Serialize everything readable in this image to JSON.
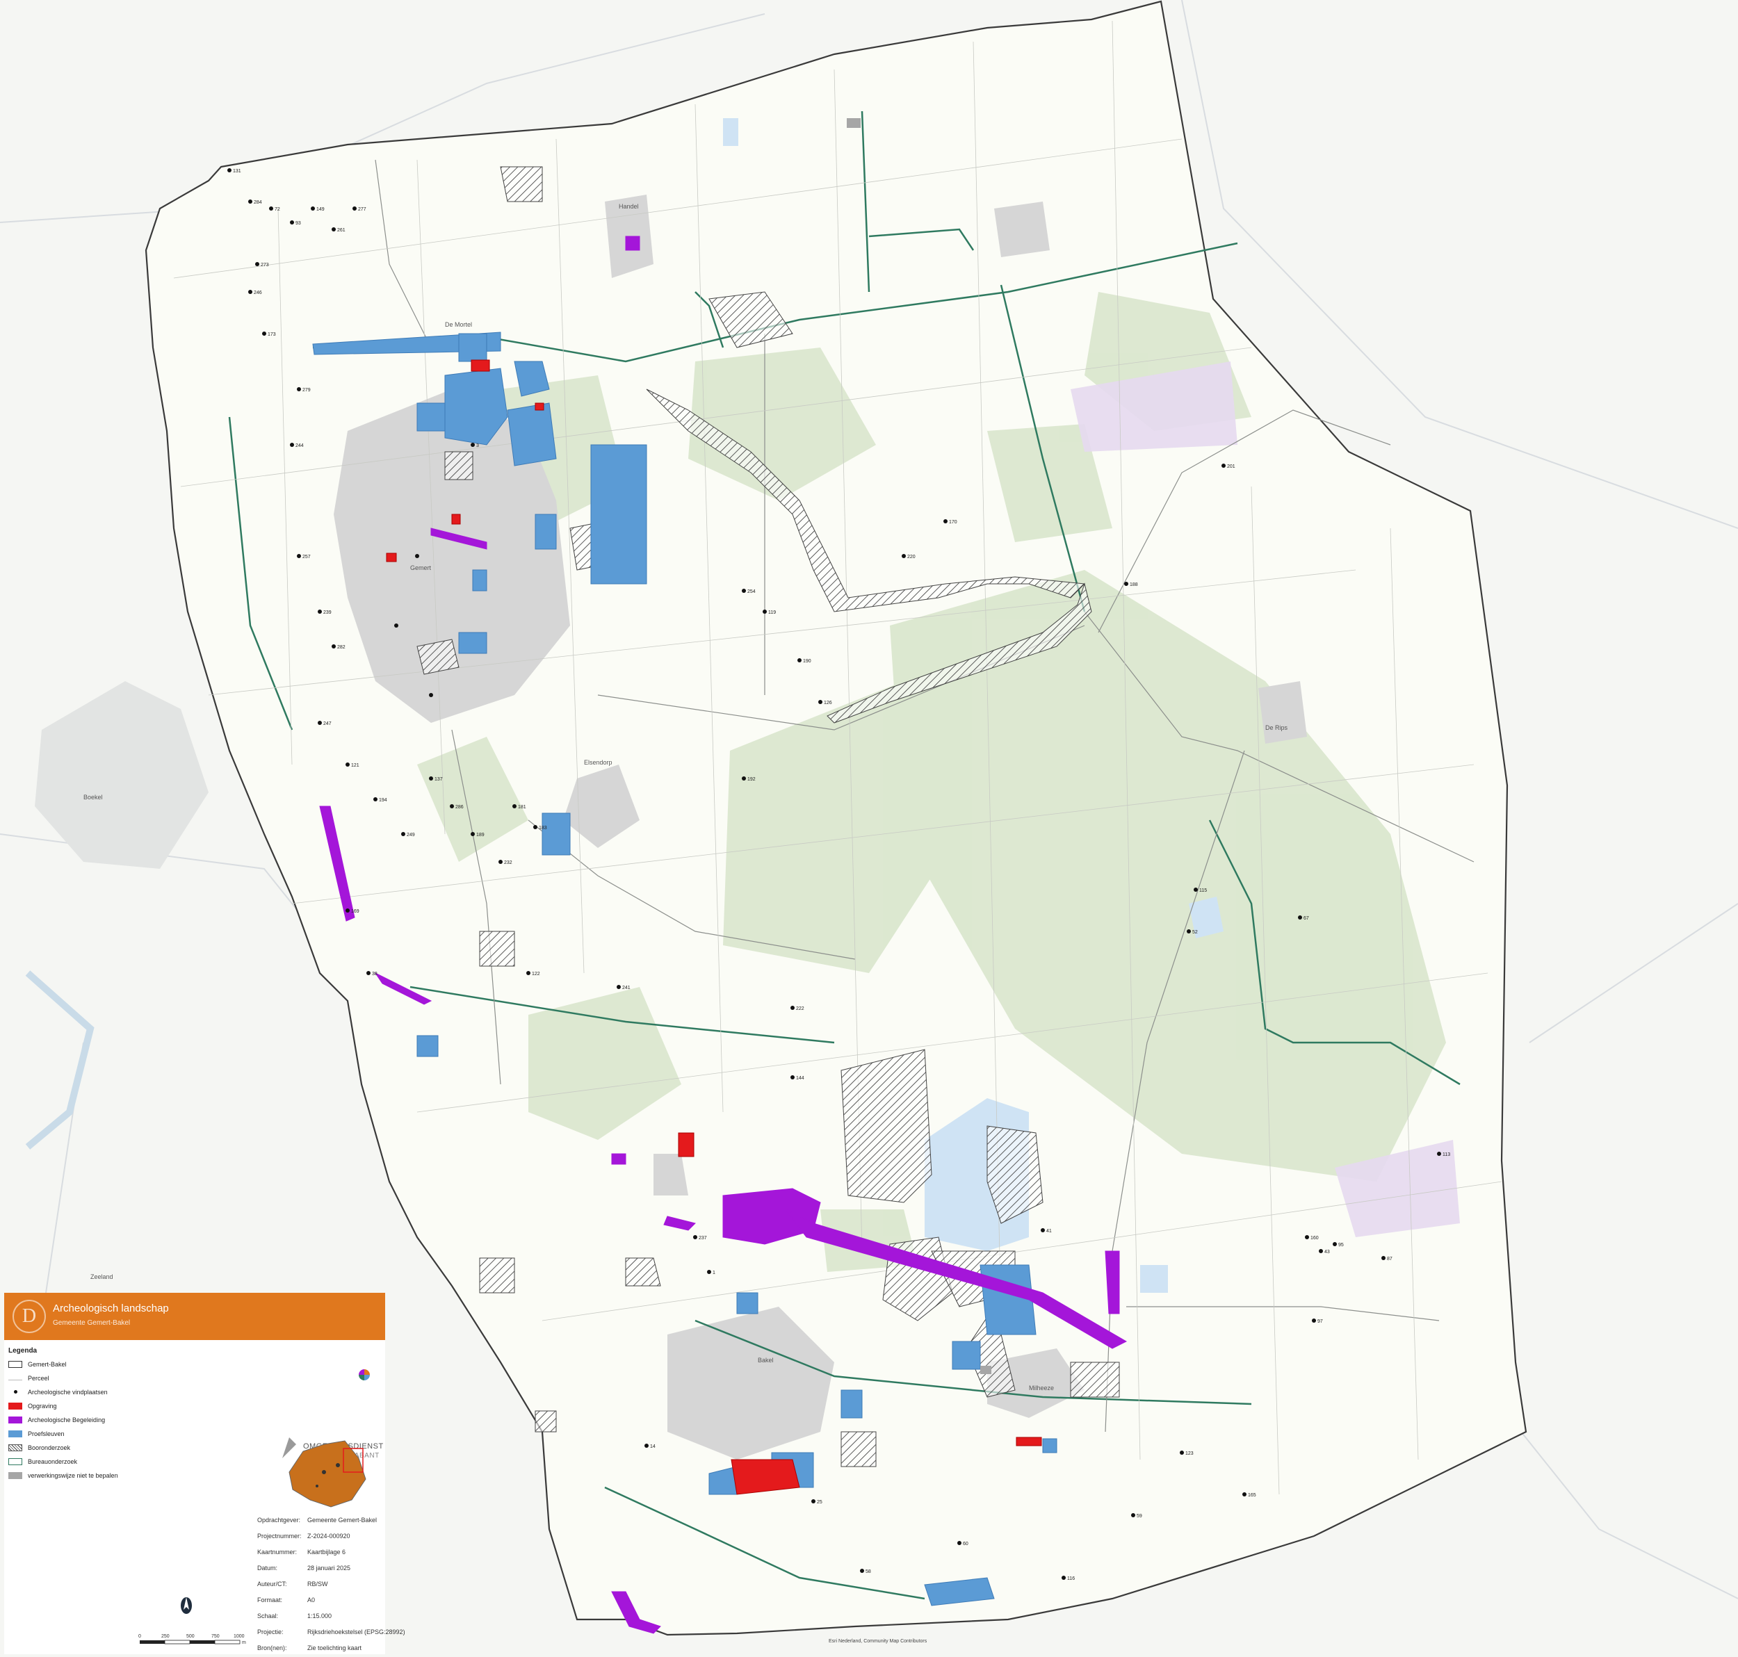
{
  "legend_panel": {
    "title": "Archeologisch landschap",
    "subtitle": "Gemeente Gemert-Bakel",
    "logo_letter": "D",
    "legend_heading": "Legenda",
    "legend_items": [
      {
        "label": "Gemert-Bakel",
        "symbol": "outline-box"
      },
      {
        "label": "Perceel",
        "symbol": "thin-line"
      },
      {
        "label": "Archeologische vindplaatsen",
        "symbol": "dot"
      },
      {
        "label": "Opgraving",
        "symbol": "fill",
        "color": "#e41a1c"
      },
      {
        "label": "Archeologische Begeleiding",
        "symbol": "fill",
        "color": "#a416d9"
      },
      {
        "label": "Proefsleuven",
        "symbol": "fill",
        "color": "#5b9bd5"
      },
      {
        "label": "Booronderzoek",
        "symbol": "hatch"
      },
      {
        "label": "Bureauonderzoek",
        "symbol": "outline-green"
      },
      {
        "label": "verwerkingswijze niet te bepalen",
        "symbol": "fill",
        "color": "#a6a6a6"
      }
    ],
    "brand_name": "OMGEVINGSDIENST",
    "brand_sub": "ZUIDOOST-BRABANT",
    "info": [
      {
        "key": "Opdrachtgever:",
        "value": "Gemeente Gemert-Bakel"
      },
      {
        "key": "Projectnummer:",
        "value": "Z-2024-000920"
      },
      {
        "key": "Kaartnummer:",
        "value": "Kaartbijlage 6"
      },
      {
        "key": "Datum:",
        "value": "28 januari 2025"
      },
      {
        "key": "Auteur/CT:",
        "value": "RB/SW"
      },
      {
        "key": "Formaat:",
        "value": "A0"
      },
      {
        "key": "Schaal:",
        "value": "1:15.000"
      },
      {
        "key": "Projectie:",
        "value": "Rijksdriehoekstelsel (EPSG:28992)"
      },
      {
        "key": "Bron(nen):",
        "value": "Zie toelichting kaart"
      }
    ],
    "scale_ticks": [
      "0",
      "250",
      "500",
      "750",
      "1000"
    ],
    "scale_unit": "m"
  },
  "map": {
    "credit": "Esri Nederland, Community Map Contributors",
    "colors": {
      "boundary": "#3a3a3a",
      "road": "#2f7a60",
      "opgraving": "#e41a1c",
      "begeleiding": "#a416d9",
      "proefsleuven": "#5b9bd5",
      "forest": "#dbe7cf",
      "heath": "#e4d6ef",
      "urban": "#d3d3d3",
      "water": "#cfe3f4"
    },
    "place_labels": [
      "De Mortel",
      "Handel",
      "Gemert",
      "Elsendorp",
      "Bakel",
      "Milheeze",
      "De Rips",
      "Boekel",
      "Zeeland"
    ],
    "site_labels": [
      "131",
      "284",
      "72",
      "93",
      "149",
      "261",
      "277",
      "273",
      "246",
      "173",
      "279",
      "244",
      "257",
      "239",
      "282",
      "247",
      "121",
      "194",
      "249",
      "137",
      "286",
      "189",
      "232",
      "181",
      "183",
      "169",
      "38",
      "122",
      "237",
      "254",
      "119",
      "220",
      "170",
      "188",
      "201",
      "190",
      "126",
      "192",
      "241",
      "222",
      "144",
      "160",
      "43",
      "95",
      "87",
      "113",
      "115",
      "52",
      "67",
      "97",
      "123",
      "165",
      "59",
      "60",
      "58",
      "116",
      "25",
      "14",
      "1",
      "41",
      "3"
    ]
  }
}
